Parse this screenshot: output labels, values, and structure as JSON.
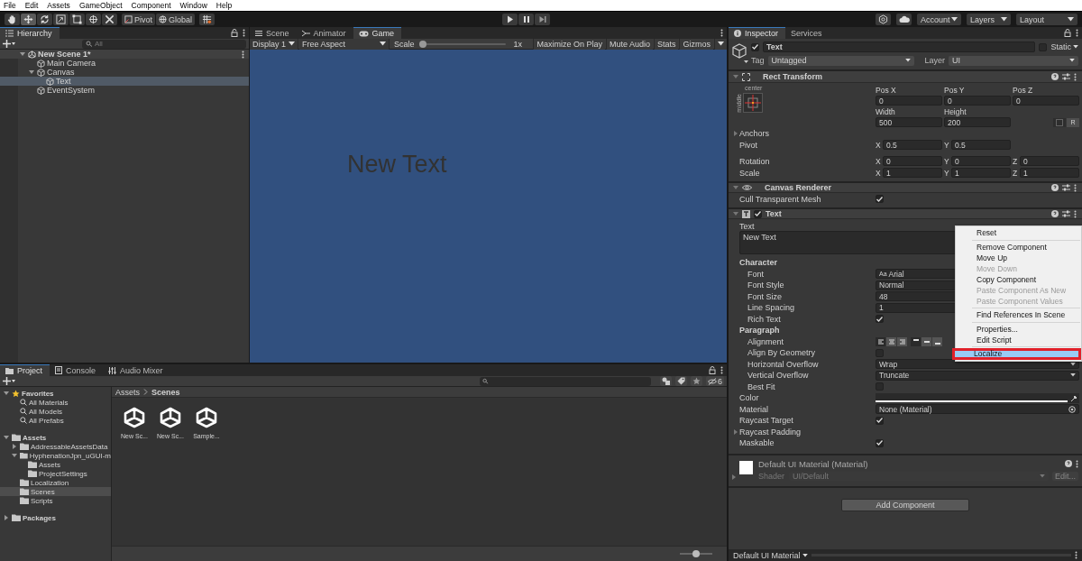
{
  "menu_bar": [
    "File",
    "Edit",
    "Assets",
    "GameObject",
    "Component",
    "Window",
    "Help"
  ],
  "toolbar": {
    "tools": [
      {
        "kind": "hand",
        "selected": false
      },
      {
        "kind": "move",
        "selected": true
      },
      {
        "kind": "rotate",
        "selected": false
      },
      {
        "kind": "scale",
        "selected": false
      },
      {
        "kind": "rect",
        "selected": false
      },
      {
        "kind": "transform",
        "selected": false
      },
      {
        "kind": "custom",
        "selected": false
      }
    ],
    "pivot": "Pivot",
    "space": "Global",
    "account": "Account",
    "layers": "Layers",
    "layout": "Layout"
  },
  "hierarchy": {
    "title": "Hierarchy",
    "search_placeholder": "All",
    "tree": [
      {
        "label": "New Scene 1*",
        "kind": "scene",
        "expanded": true,
        "selected": false,
        "children": [
          {
            "label": "Main Camera",
            "kind": "object",
            "selected": false
          },
          {
            "label": "Canvas",
            "kind": "object",
            "expanded": true,
            "selected": false,
            "children": [
              {
                "label": "Text",
                "kind": "object",
                "selected": true
              }
            ]
          },
          {
            "label": "EventSystem",
            "kind": "object",
            "selected": false
          }
        ]
      }
    ]
  },
  "game_view": {
    "tabs": [
      {
        "label": "Scene",
        "kind": "scene",
        "selected": false
      },
      {
        "label": "Animator",
        "kind": "animator",
        "selected": false
      },
      {
        "label": "Game",
        "kind": "game",
        "selected": true
      }
    ],
    "display": "Display 1",
    "aspect": "Free Aspect",
    "scale_label": "Scale",
    "scale": {
      "level": 0
    },
    "scale_value": "1x",
    "buttons": [
      "Maximize On Play",
      "Mute Audio",
      "Stats",
      "Gizmos"
    ],
    "canvas_text": "New Text"
  },
  "project": {
    "tabs": [
      {
        "label": "Project",
        "kind": "folder",
        "selected": true
      },
      {
        "label": "Console",
        "kind": "console",
        "selected": false
      },
      {
        "label": "Audio Mixer",
        "kind": "mixer",
        "selected": false
      }
    ],
    "hidden_count": "6",
    "tree": [
      {
        "label": "Favorites",
        "kind": "favorites",
        "expanded": true,
        "selected": false,
        "children": [
          {
            "label": "All Materials",
            "kind": "search",
            "selected": false
          },
          {
            "label": "All Models",
            "kind": "search",
            "selected": false
          },
          {
            "label": "All Prefabs",
            "kind": "search",
            "selected": false
          }
        ]
      },
      {
        "label": "Assets",
        "kind": "folder",
        "expanded": true,
        "selected": false,
        "children": [
          {
            "label": "AddressableAssetsData",
            "kind": "folder",
            "expanded": false,
            "selected": false
          },
          {
            "label": "HyphenationJpn_uGUI-m",
            "kind": "folder",
            "expanded": true,
            "selected": false,
            "children": [
              {
                "label": "Assets",
                "kind": "folder",
                "selected": false
              },
              {
                "label": "ProjectSettings",
                "kind": "folder",
                "selected": false
              }
            ]
          },
          {
            "label": "Localization",
            "kind": "folder",
            "selected": false
          },
          {
            "label": "Scenes",
            "kind": "folder",
            "selected": true
          },
          {
            "label": "Scripts",
            "kind": "folder",
            "selected": false
          }
        ]
      },
      {
        "label": "Packages",
        "kind": "folder",
        "expanded": false,
        "selected": false
      }
    ],
    "breadcrumb": [
      "Assets",
      "Scenes"
    ],
    "files": [
      "New Sc...",
      "New Sc...",
      "Sample..."
    ],
    "zoom": {
      "level": 0.5
    }
  },
  "inspector": {
    "tabs": [
      {
        "label": "Inspector",
        "selected": true
      },
      {
        "label": "Services",
        "selected": false
      }
    ],
    "object": {
      "active": true,
      "name": "Text",
      "static": false,
      "static_label": "Static",
      "tag_label": "Tag",
      "tag": "Untagged",
      "layer_label": "Layer",
      "layer": "UI"
    },
    "rect_transform": {
      "title": "Rect Transform",
      "anchor_h": "center",
      "anchor_v": "middle",
      "pos": [
        {
          "label": "Pos X",
          "value": "0"
        },
        {
          "label": "Pos Y",
          "value": "0"
        },
        {
          "label": "Pos Z",
          "value": "0"
        }
      ],
      "size": [
        {
          "label": "Width",
          "value": "500"
        },
        {
          "label": "Height",
          "value": "200"
        }
      ],
      "raw_label": "R",
      "anchors": "Anchors",
      "pivot": {
        "label": "Pivot",
        "values": [
          {
            "axis": "X",
            "value": "0.5"
          },
          {
            "axis": "Y",
            "value": "0.5"
          }
        ]
      },
      "rotation": {
        "label": "Rotation",
        "values": [
          {
            "axis": "X",
            "value": "0"
          },
          {
            "axis": "Y",
            "value": "0"
          },
          {
            "axis": "Z",
            "value": "0"
          }
        ]
      },
      "scale": {
        "label": "Scale",
        "values": [
          {
            "axis": "X",
            "value": "1"
          },
          {
            "axis": "Y",
            "value": "1"
          },
          {
            "axis": "Z",
            "value": "1"
          }
        ]
      }
    },
    "canvas_renderer": {
      "title": "Canvas Renderer",
      "rows": [
        {
          "label": "Cull Transparent Mesh",
          "checked": true
        }
      ]
    },
    "text_component": {
      "title": "Text",
      "enabled": true,
      "text_label": "Text",
      "text": "New Text",
      "rows": [
        {
          "kind": "header",
          "label": "Character"
        },
        {
          "kind": "font",
          "label": "Font",
          "glyph": "Aa",
          "value": "Arial"
        },
        {
          "kind": "dropdown",
          "label": "Font Style",
          "value": "Normal"
        },
        {
          "kind": "field",
          "label": "Font Size",
          "value": "48"
        },
        {
          "kind": "field",
          "label": "Line Spacing",
          "value": "1"
        },
        {
          "kind": "check",
          "label": "Rich Text",
          "checked": true,
          "indent": true
        },
        {
          "kind": "header",
          "label": "Paragraph"
        },
        {
          "kind": "align",
          "label": "Alignment",
          "h": [
            {
              "selected": true
            },
            {
              "selected": false
            },
            {
              "selected": false
            }
          ],
          "v": [
            {
              "selected": true
            },
            {
              "selected": false
            },
            {
              "selected": false
            }
          ]
        },
        {
          "kind": "check",
          "label": "Align By Geometry",
          "checked": false,
          "indent": true
        },
        {
          "kind": "dropdown",
          "label": "Horizontal Overflow",
          "value": "Wrap"
        },
        {
          "kind": "dropdown",
          "label": "Vertical Overflow",
          "value": "Truncate"
        },
        {
          "kind": "check",
          "label": "Best Fit",
          "checked": false,
          "indent": true
        },
        {
          "kind": "color",
          "label": "Color",
          "color": "#ffffff"
        },
        {
          "kind": "object",
          "label": "Material",
          "value": "None (Material)"
        },
        {
          "kind": "check",
          "label": "Raycast Target",
          "checked": true,
          "indent": false
        },
        {
          "kind": "foldout",
          "label": "Raycast Padding",
          "expanded": false
        },
        {
          "kind": "check",
          "label": "Maskable",
          "checked": true,
          "indent": false
        }
      ]
    },
    "material": {
      "name": "Default UI Material (Material)",
      "shader_label": "Shader",
      "shader": "UI/Default",
      "edit": "Edit..."
    },
    "add_component": "Add Component",
    "footer": "Default UI Material"
  },
  "context_menu": {
    "items": [
      {
        "kind": "item",
        "label": "Reset",
        "disabled": false,
        "selected": false,
        "framed": false
      },
      {
        "kind": "separator"
      },
      {
        "kind": "item",
        "label": "Remove Component",
        "disabled": false,
        "selected": false,
        "framed": false
      },
      {
        "kind": "item",
        "label": "Move Up",
        "disabled": false,
        "selected": false,
        "framed": false
      },
      {
        "kind": "item",
        "label": "Move Down",
        "disabled": true,
        "selected": false,
        "framed": false
      },
      {
        "kind": "item",
        "label": "Copy Component",
        "disabled": false,
        "selected": false,
        "framed": false
      },
      {
        "kind": "item",
        "label": "Paste Component As New",
        "disabled": true,
        "selected": false,
        "framed": false
      },
      {
        "kind": "item",
        "label": "Paste Component Values",
        "disabled": true,
        "selected": false,
        "framed": false
      },
      {
        "kind": "separator"
      },
      {
        "kind": "item",
        "label": "Find References In Scene",
        "disabled": false,
        "selected": false,
        "framed": false
      },
      {
        "kind": "separator"
      },
      {
        "kind": "item",
        "label": "Properties...",
        "disabled": false,
        "selected": false,
        "framed": false
      },
      {
        "kind": "item",
        "label": "Edit Script",
        "disabled": false,
        "selected": false,
        "framed": false
      },
      {
        "kind": "separator"
      },
      {
        "kind": "item",
        "label": "Localize",
        "disabled": false,
        "selected": true,
        "framed": true
      }
    ]
  }
}
